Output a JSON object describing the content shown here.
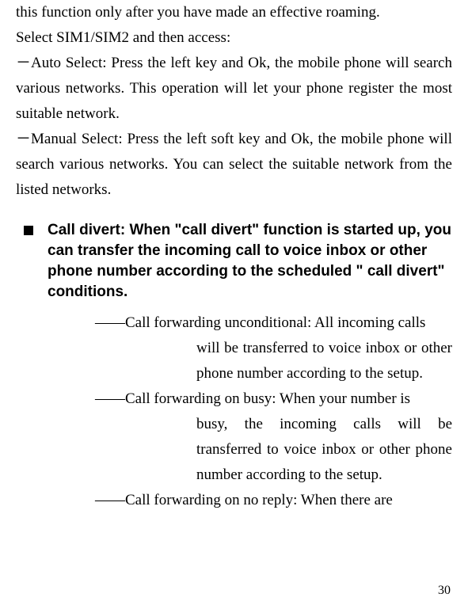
{
  "intro": {
    "line1": "this function only after you have made an effective roaming.",
    "line2": "Select SIM1/SIM2 and then access:",
    "auto": "－Auto Select: Press the left key and Ok, the mobile phone will search various networks. This operation will let your phone register the most suitable network.",
    "manual": "－Manual Select: Press the left soft key and Ok, the mobile phone will search various networks. You can select the suitable network from the listed networks."
  },
  "bullet": {
    "heading": "Call divert: When \"call divert\" function is started up, you can transfer the incoming call to voice inbox or other phone number according to the scheduled \" call divert\" conditions."
  },
  "subitems": {
    "a_first": "――Call forwarding unconditional: All incoming calls",
    "a_cont": "will be transferred to voice inbox or other phone number according to the setup.",
    "b_first": "――Call forwarding on busy: When your number is",
    "b_cont": "busy, the incoming calls will be transferred to voice inbox or other phone number according to the setup.",
    "c_first": "――Call forwarding on no reply: When there are"
  },
  "page_number": "30"
}
